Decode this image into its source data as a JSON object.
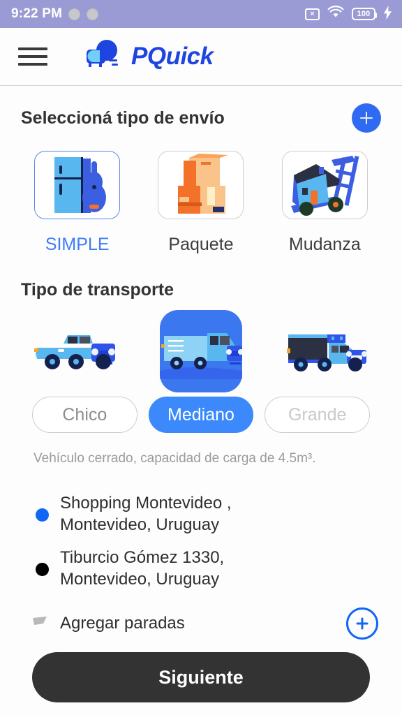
{
  "statusbar": {
    "time": "9:22 PM",
    "nosim_icon": "no-sim-icon",
    "nosim_glyph": "×",
    "wifi_icon": "wifi-icon",
    "battery_icon": "battery-icon",
    "battery_level": "100",
    "charging_icon": "charging-bolt-icon",
    "charging_glyph": "⚡"
  },
  "header": {
    "menu_icon": "hamburger-menu-icon",
    "logo_icon": "pquick-van-logo-icon",
    "brand": "PQuick"
  },
  "shipping": {
    "title": "Seleccioná tipo de envío",
    "add_label": "+",
    "options": [
      {
        "label": "SIMPLE",
        "icon": "fridge-guitar-icon",
        "selected": true
      },
      {
        "label": "Paquete",
        "icon": "boxes-icon",
        "selected": false
      },
      {
        "label": "Mudanza",
        "icon": "house-dolly-icon",
        "selected": false
      }
    ]
  },
  "transport": {
    "title": "Tipo de transporte",
    "options": [
      {
        "label": "Chico",
        "icon": "pickup-truck-icon",
        "selected": false,
        "dim": false
      },
      {
        "label": "Mediano",
        "icon": "van-icon",
        "selected": true,
        "dim": false
      },
      {
        "label": "Grande",
        "icon": "box-truck-icon",
        "selected": false,
        "dim": true
      }
    ],
    "description": "Vehículo cerrado, capacidad de carga de 4.5m³."
  },
  "addresses": [
    {
      "text": "Shopping Montevideo ,\nMontevideo, Uruguay",
      "marker": "origin"
    },
    {
      "text": "Tiburcio Gómez 1330,\nMontevideo, Uruguay",
      "marker": "destination"
    }
  ],
  "stops": {
    "label": "Agregar paradas",
    "pin_icon": "map-pin-icon",
    "add_icon": "add-stop-icon"
  },
  "footer": {
    "next_label": "Siguiente"
  },
  "colors": {
    "statusbar": "#9a9bd4",
    "brand_blue": "#1f45e0",
    "accent_blue": "#3b89fb",
    "selected_pill": "#3b89fb",
    "origin_dot": "#1166f5",
    "destination_dot": "#000000",
    "next_button": "#333333"
  }
}
